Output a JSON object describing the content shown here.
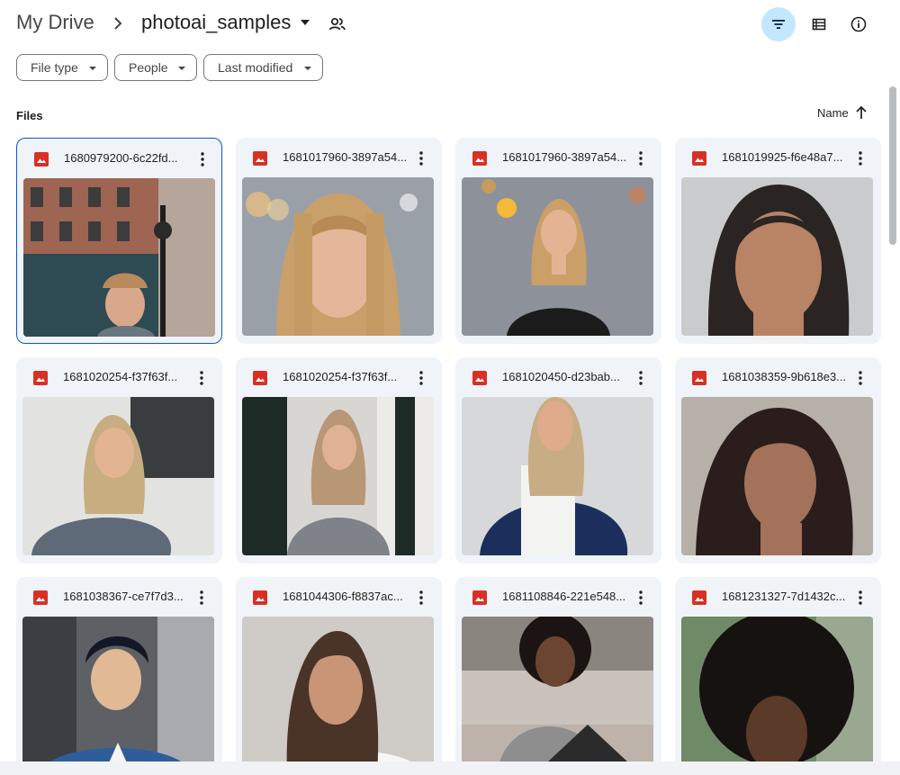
{
  "breadcrumb": {
    "root": "My Drive",
    "current": "photoai_samples"
  },
  "filters": [
    {
      "label": "File type"
    },
    {
      "label": "People"
    },
    {
      "label": "Last modified"
    }
  ],
  "section_title": "Files",
  "sort": {
    "label": "Name",
    "direction": "ascending"
  },
  "icons": {
    "crumb_separator": "chevron-right-icon",
    "folder_menu": "caret-down-icon",
    "shared": "people-icon",
    "filter": "filter-icon",
    "list_view": "list-view-icon",
    "details": "info-icon",
    "file_type": "image-file-icon",
    "more": "more-vert-icon"
  },
  "colors": {
    "accent": "#0b57d0",
    "active_button": "#c2e7ff",
    "card_bg": "#f0f4f9",
    "image_icon": "#d93025"
  },
  "files": [
    {
      "name": "1680979200-6c22fd...",
      "selected": true,
      "thumb": "man-street"
    },
    {
      "name": "1681017960-3897a54...",
      "thumb": "blonde-close"
    },
    {
      "name": "1681017960-3897a54...",
      "thumb": "blonde-black-top"
    },
    {
      "name": "1681019925-f6e48a7...",
      "thumb": "darkhair-grey"
    },
    {
      "name": "1681020254-f37f63f...",
      "thumb": "grey-sweater"
    },
    {
      "name": "1681020254-f37f63f...",
      "thumb": "grey-sweater-door"
    },
    {
      "name": "1681020450-d23bab...",
      "thumb": "navy-cardigan"
    },
    {
      "name": "1681038359-9b618e3...",
      "thumb": "darkhair-outdoor"
    },
    {
      "name": "1681038367-ce7f7d3...",
      "thumb": "man-blue-suit"
    },
    {
      "name": "1681044306-f8837ac...",
      "thumb": "white-tee"
    },
    {
      "name": "1681108846-221e548...",
      "thumb": "curly-sofa"
    },
    {
      "name": "1681231327-7d1432c...",
      "thumb": "afro-green"
    }
  ]
}
